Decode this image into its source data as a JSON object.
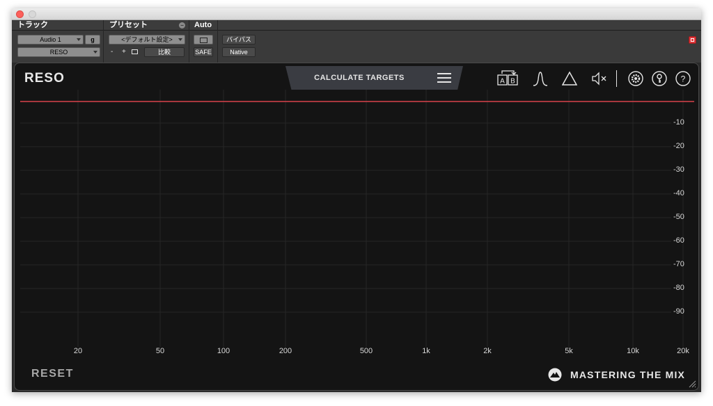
{
  "header": {
    "track_label": "トラック",
    "preset_label": "プリセット",
    "auto_label": "Auto"
  },
  "track": {
    "name": "Audio 1",
    "group": "g",
    "plugin_name": "RESO"
  },
  "preset": {
    "current": "<デフォルト設定>",
    "minus": "-",
    "plus": "+",
    "compare": "比較"
  },
  "auto": {
    "safe": "SAFE"
  },
  "bypass": {
    "label": "バイパス",
    "mode": "Native"
  },
  "plugin": {
    "title": "RESO",
    "calculate_label": "CALCULATE TARGETS",
    "reset_label": "RESET",
    "brand": "MASTERING THE MIX",
    "ab_a": "A",
    "ab_b": "B"
  },
  "graph": {
    "y_labels": [
      "-10",
      "-20",
      "-30",
      "-40",
      "-50",
      "-60",
      "-70",
      "-80",
      "-90"
    ],
    "x_labels": [
      "20",
      "50",
      "100",
      "200",
      "500",
      "1k",
      "2k",
      "5k",
      "10k",
      "20k"
    ]
  },
  "colors": {
    "accent_red": "#d9434b",
    "plugin_bg": "#141414",
    "tab_bg": "#3a3c42"
  },
  "icons": [
    "ab-compare-icon",
    "bell-filter-icon",
    "delta-icon",
    "mute-icon",
    "gear-icon",
    "key-icon",
    "help-icon"
  ]
}
